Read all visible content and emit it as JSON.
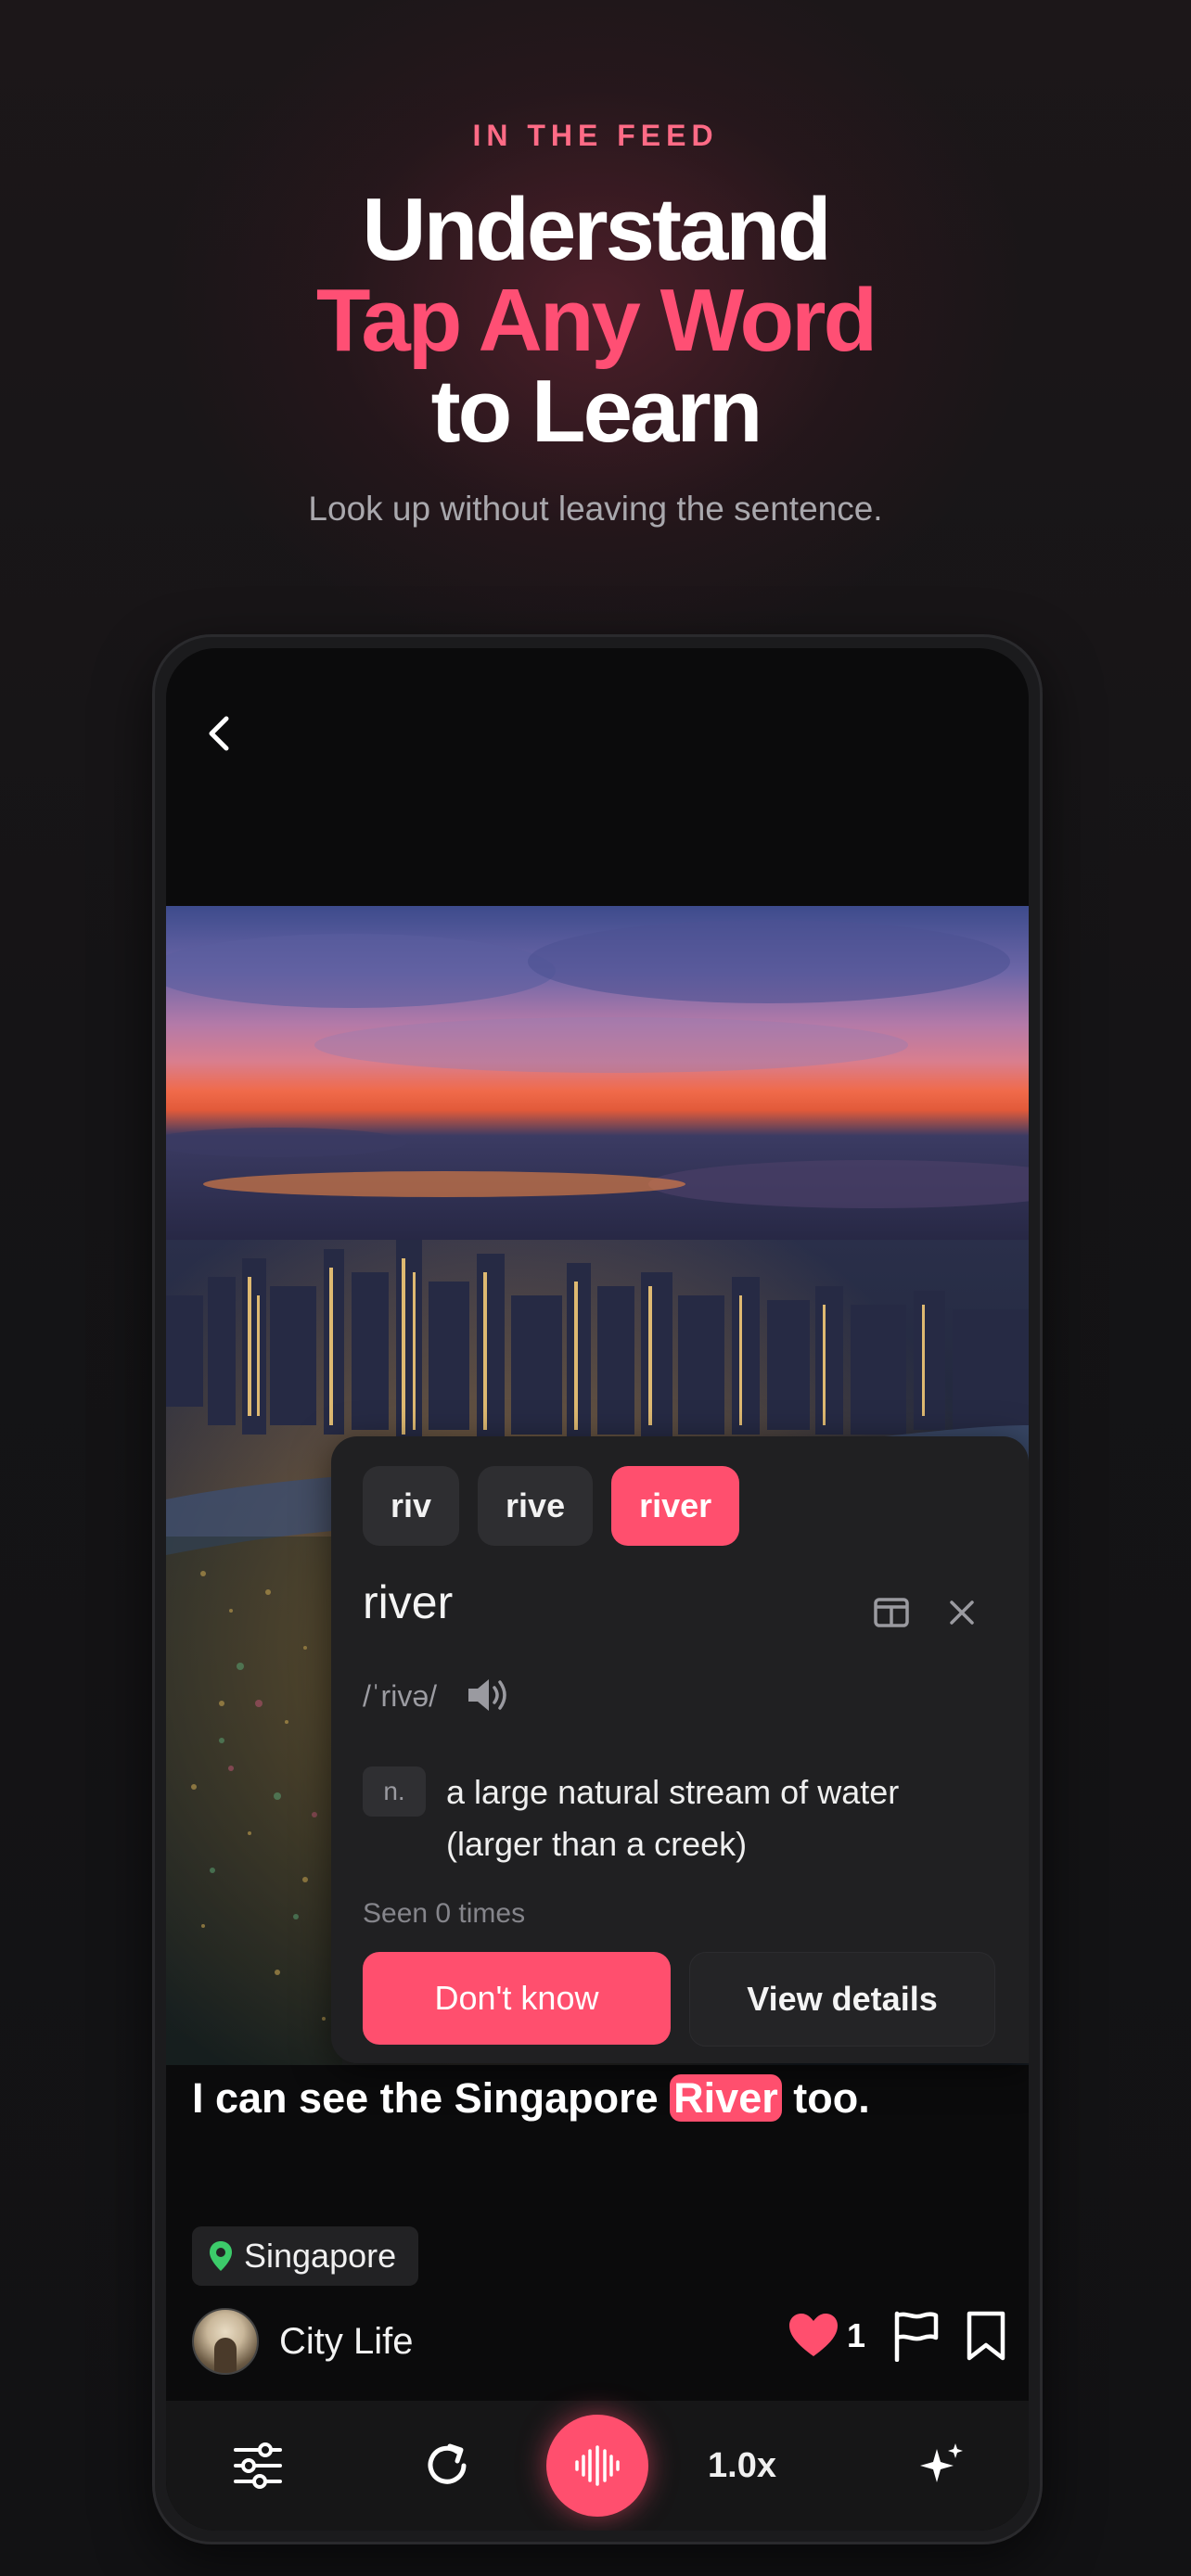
{
  "hero": {
    "eyebrow": "IN THE FEED",
    "line1": "Understand",
    "line2": "Tap Any Word",
    "line3": "to Learn",
    "subtitle": "Look up without leaving the sentence."
  },
  "popup": {
    "chips": [
      "riv",
      "rive",
      "river"
    ],
    "active_chip": "river",
    "word": "river",
    "phonetic": "/ˈrivə/",
    "part_of_speech": "n.",
    "definition": "a large natural stream of water (larger than a creek)",
    "seen": "Seen 0 times",
    "dont_know": "Don't know",
    "view_details": "View details"
  },
  "caption": {
    "before": "I can see the Singapore ",
    "highlight": "River",
    "after": " too."
  },
  "meta": {
    "location": "Singapore",
    "author": "City Life",
    "likes": "1"
  },
  "bottom_bar": {
    "speed": "1.0x"
  },
  "colors": {
    "accent": "#ff4f6e",
    "eyebrow": "#ff6b86",
    "background": "#141416",
    "location_pin": "#3ccb6a"
  },
  "icons": [
    "back-chevron-icon",
    "sidebar-panel-icon",
    "close-icon",
    "speaker-icon",
    "location-pin-icon",
    "heart-icon",
    "flag-icon",
    "bookmark-icon",
    "sliders-icon",
    "replay-icon",
    "waveform-icon",
    "sparkles-icon"
  ]
}
